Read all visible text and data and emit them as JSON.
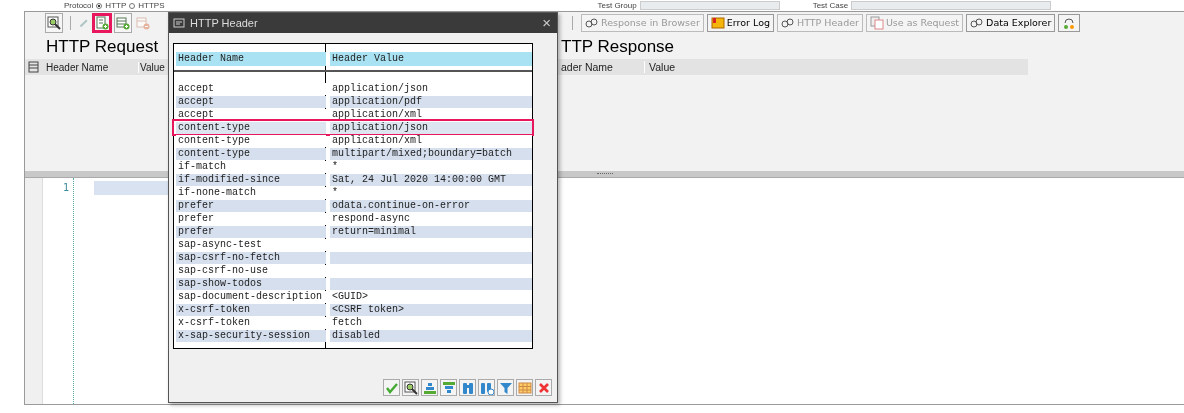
{
  "header_strip": {
    "protocol_label": "Protocol",
    "options": [
      {
        "label": "HTTP",
        "selected": true
      },
      {
        "label": "HTTPS",
        "selected": false
      }
    ],
    "test_group_label": "Test Group",
    "test_case_label": "Test Case"
  },
  "request_panel": {
    "toolbar": [
      {
        "kind": "zoom",
        "disabled": false,
        "highlighted": false
      },
      {
        "kind": "separator"
      },
      {
        "kind": "pencil",
        "disabled": true,
        "highlighted": false
      },
      {
        "kind": "add-row",
        "disabled": false,
        "highlighted": true
      },
      {
        "kind": "insert-row",
        "disabled": false,
        "highlighted": false
      },
      {
        "kind": "delete-row",
        "disabled": true,
        "highlighted": false
      }
    ],
    "title": "HTTP Request",
    "columns": [
      "Header Name",
      "Value"
    ]
  },
  "response_panel": {
    "toolbar": [
      {
        "kind": "link",
        "label": "Response in Browser",
        "disabled": true
      },
      {
        "kind": "log",
        "label": "Error Log",
        "disabled": false
      },
      {
        "kind": "link",
        "label": "HTTP Header",
        "disabled": true
      },
      {
        "kind": "copy",
        "label": "Use as Request",
        "disabled": true
      },
      {
        "kind": "link",
        "label": "Data Explorer",
        "disabled": false
      },
      {
        "kind": "signal",
        "disabled": false
      }
    ],
    "title": "TTP Response",
    "columns": [
      "ader Name",
      "Value"
    ]
  },
  "editor": {
    "line_numbers": [
      "1"
    ]
  },
  "dialog": {
    "title": "HTTP Header",
    "close": "×",
    "columns": [
      "Header Name",
      "Header Value"
    ],
    "rows": [
      {
        "name": "accept",
        "value": "application/json",
        "selected": false
      },
      {
        "name": "accept",
        "value": "application/pdf",
        "selected": false
      },
      {
        "name": "accept",
        "value": "application/xml",
        "selected": false
      },
      {
        "name": "content-type",
        "value": "application/json",
        "selected": true
      },
      {
        "name": "content-type",
        "value": "application/xml",
        "selected": false
      },
      {
        "name": "content-type",
        "value": "multipart/mixed;boundary=batch",
        "selected": false
      },
      {
        "name": "if-match",
        "value": "*",
        "selected": false
      },
      {
        "name": "if-modified-since",
        "value": "Sat, 24 Jul 2020 14:00:00 GMT",
        "selected": false
      },
      {
        "name": "if-none-match",
        "value": "*",
        "selected": false
      },
      {
        "name": "prefer",
        "value": "odata.continue-on-error",
        "selected": false
      },
      {
        "name": "prefer",
        "value": "respond-async",
        "selected": false
      },
      {
        "name": "prefer",
        "value": "return=minimal",
        "selected": false
      },
      {
        "name": "sap-async-test",
        "selected": false
      },
      {
        "name": "sap-csrf-no-fetch",
        "selected": false
      },
      {
        "name": "sap-csrf-no-use",
        "selected": false
      },
      {
        "name": "sap-show-todos",
        "selected": false
      },
      {
        "name": "sap-document-description",
        "value": "<GUID>",
        "selected": false
      },
      {
        "name": "x-csrf-token",
        "value": "<CSRF token>",
        "selected": false
      },
      {
        "name": "x-csrf-token",
        "value": "fetch",
        "selected": false
      },
      {
        "name": "x-sap-security-session",
        "value": "disabled",
        "selected": false
      }
    ],
    "buttons": [
      {
        "kind": "check"
      },
      {
        "kind": "details"
      },
      {
        "kind": "sort-up"
      },
      {
        "kind": "sort-down"
      },
      {
        "kind": "find"
      },
      {
        "kind": "find-next"
      },
      {
        "kind": "filter"
      },
      {
        "kind": "layout"
      },
      {
        "kind": "cancel"
      }
    ]
  }
}
